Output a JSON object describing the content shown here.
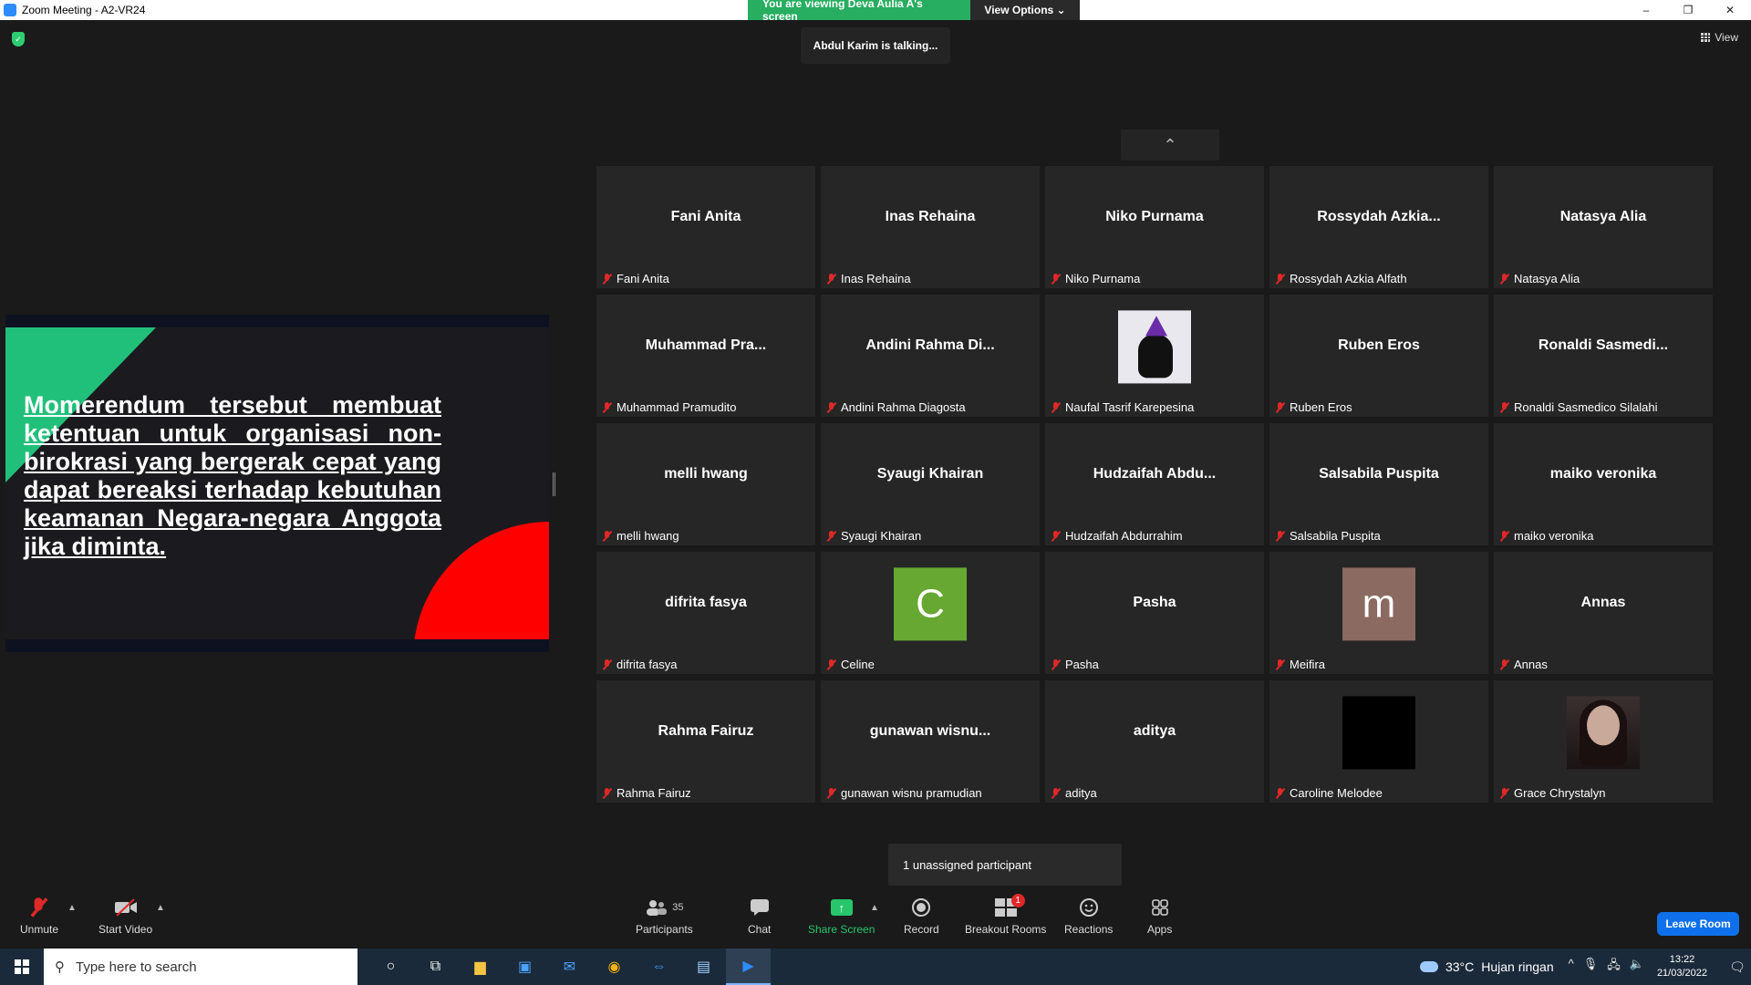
{
  "window": {
    "title": "Zoom Meeting - A2-VR24",
    "minimize": "–",
    "restore": "❐",
    "close": "✕"
  },
  "banner": {
    "viewing": "You are viewing Deva Aulia A's screen",
    "view_options": "View Options ⌄"
  },
  "talking": "Abdul Karim is talking...",
  "view_label": "View",
  "scroll_up": "⌃",
  "shared_slide": {
    "text": "Momerendum tersebut membuat ketentuan untuk organisasi non-birokrasi yang bergerak cepat yang dapat bereaksi terhadap kebutuhan keamanan Negara-negara Anggota jika diminta."
  },
  "participants": [
    {
      "center": "Fani Anita",
      "label": "Fani Anita"
    },
    {
      "center": "Inas Rehaina",
      "label": "Inas Rehaina"
    },
    {
      "center": "Niko Purnama",
      "label": "Niko Purnama"
    },
    {
      "center": "Rossydah  Azkia...",
      "label": "Rossydah Azkia Alfath"
    },
    {
      "center": "Natasya Alia",
      "label": "Natasya Alia"
    },
    {
      "center": "Muhammad  Pra...",
      "label": "Muhammad Pramudito"
    },
    {
      "center": "Andini  Rahma  Di...",
      "label": "Andini Rahma Diagosta"
    },
    {
      "center": "",
      "label": "Naufal Tasrif Karepesina",
      "avatar": "cat"
    },
    {
      "center": "Ruben Eros",
      "label": "Ruben Eros"
    },
    {
      "center": "Ronaldi  Sasmedi...",
      "label": "Ronaldi Sasmedico Silalahi"
    },
    {
      "center": "melli hwang",
      "label": "melli hwang"
    },
    {
      "center": "Syaugi Khairan",
      "label": "Syaugi Khairan"
    },
    {
      "center": "Hudzaifah  Abdu...",
      "label": "Hudzaifah Abdurrahim"
    },
    {
      "center": "Salsabila Puspita",
      "label": "Salsabila Puspita"
    },
    {
      "center": "maiko veronika",
      "label": "maiko veronika"
    },
    {
      "center": "difrita fasya",
      "label": "difrita fasya"
    },
    {
      "center": "",
      "label": "Celine",
      "avatar": "letter",
      "letter": "C",
      "avatar_color": "#66a832"
    },
    {
      "center": "Pasha",
      "label": "Pasha"
    },
    {
      "center": "",
      "label": "Meifira",
      "avatar": "letter",
      "letter": "m",
      "avatar_color": "#8b6a62"
    },
    {
      "center": "Annas",
      "label": "Annas"
    },
    {
      "center": "Rahma Fairuz",
      "label": "Rahma Fairuz"
    },
    {
      "center": "gunawan  wisnu...",
      "label": "gunawan wisnu pramudian"
    },
    {
      "center": "aditya",
      "label": "aditya"
    },
    {
      "center": "",
      "label": "Caroline Melodee",
      "avatar": "black"
    },
    {
      "center": "",
      "label": "Grace Chrystalyn",
      "avatar": "photo"
    }
  ],
  "unassigned": "1 unassigned participant",
  "toolbar": {
    "unmute": "Unmute",
    "start_video": "Start Video",
    "participants": "Participants",
    "participants_count": "35",
    "chat": "Chat",
    "share_screen": "Share Screen",
    "record": "Record",
    "breakout_rooms": "Breakout Rooms",
    "breakout_badge": "1",
    "reactions": "Reactions",
    "apps": "Apps",
    "leave": "Leave Room"
  },
  "taskbar": {
    "search_placeholder": "Type here to search",
    "weather_temp": "33°C",
    "weather_desc": "Hujan ringan",
    "time": "13:22",
    "date": "21/03/2022"
  },
  "colors": {
    "share_green": "#27c66b",
    "leave_blue": "#0e71eb",
    "mute_red": "#e02828"
  }
}
